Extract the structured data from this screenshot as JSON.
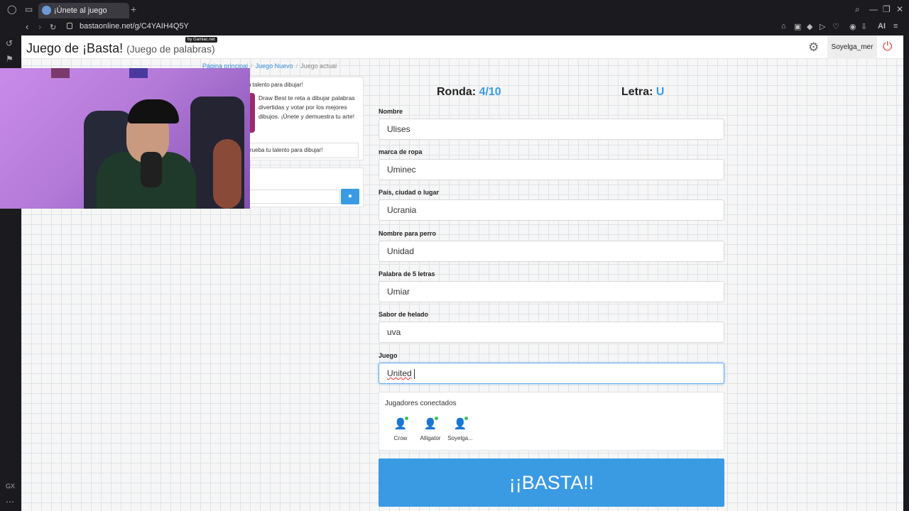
{
  "browser": {
    "tab_title": "¡Únete al juego Basta!",
    "url": "bastaonline.net/g/C4YAIH4Q5Y",
    "ai_label": "AI",
    "gx_label": "GX"
  },
  "header": {
    "title": "Juego de ¡Basta!",
    "subtitle": "(Juego de palabras)",
    "badge": "by Gamiac.net",
    "username": "Soyelga_mer"
  },
  "breadcrumb": {
    "home": "Página principal",
    "new_game": "Juego Nuevo",
    "current": "Juego actual"
  },
  "promo": {
    "heading": "u talento para dibujar!",
    "text": "Draw Best te reta a dibujar palabras divertidas y votar por los mejores dibujos. ¡Únete y demuestra tu arte!",
    "button": "rueba tu talento para dibujar!"
  },
  "game": {
    "round_label": "Ronda:",
    "round_value": "4/10",
    "letter_label": "Letra:",
    "letter_value": "U",
    "fields": [
      {
        "label": "Nombre",
        "value": "Ulises"
      },
      {
        "label": "marca de ropa",
        "value": "Uminec"
      },
      {
        "label": "País, ciudad o lugar",
        "value": "Ucrania"
      },
      {
        "label": "Nombre para perro",
        "value": "Unidad"
      },
      {
        "label": "Palabra de 5 letras",
        "value": "Umiar"
      },
      {
        "label": "Sabor de helado",
        "value": "uva"
      },
      {
        "label": "Juego",
        "value": "United"
      }
    ],
    "players_title": "Jugadores conectados",
    "players": [
      "Crow",
      "Alligator",
      "Soyelga..."
    ],
    "basta_button": "¡¡BASTA!!"
  },
  "colors": {
    "accent": "#3a9be2",
    "online": "#3cc35a",
    "power": "#e0463f"
  }
}
